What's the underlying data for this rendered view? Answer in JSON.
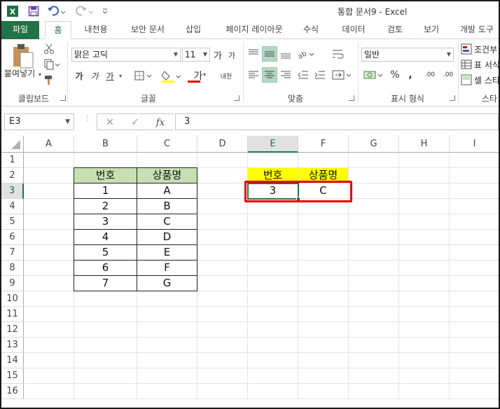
{
  "titlebar": {
    "title": "통합 문서9 - Excel",
    "icons": [
      "excel-logo-icon",
      "save-icon",
      "undo-icon",
      "redo-icon",
      "customize-qat-icon"
    ]
  },
  "tabs": [
    "파일",
    "홈",
    "내전용",
    "보안 문서",
    "삽입",
    "페이지 레이아웃",
    "수식",
    "데이터",
    "검토",
    "보기",
    "개발 도구"
  ],
  "ribbon": {
    "clipboard": {
      "paste": "붙여넣기",
      "label": "클립보드"
    },
    "font": {
      "name": "맑은 고딕",
      "size": "11",
      "label": "글꼴",
      "bold": "가",
      "italic": "가",
      "underline": "가",
      "grow": "가",
      "shrink": "가",
      "font_color": "가",
      "phonetic": "내천"
    },
    "alignment": {
      "label": "맞춤"
    },
    "number": {
      "format": "일반",
      "label": "표시 형식",
      "percent": "%",
      "comma": ",",
      "inc_decimal": ".00",
      "dec_decimal": ".00"
    },
    "styles": {
      "conditional": "조건부",
      "table": "표 서식",
      "cell": "셀 스타",
      "label": "스타"
    },
    "colors": {
      "accent": "#217346",
      "selected": "#b6d7c5"
    }
  },
  "formula_bar": {
    "name_box": "E3",
    "formula": "3",
    "fx": "fx"
  },
  "sheet": {
    "columns": [
      "A",
      "B",
      "C",
      "D",
      "E",
      "F",
      "G",
      "H",
      "I"
    ],
    "rows": [
      "1",
      "2",
      "3",
      "4",
      "5",
      "6",
      "7",
      "8",
      "9",
      "10",
      "11",
      "12",
      "13",
      "14",
      "15",
      "16"
    ],
    "active_column": "E",
    "active_row": "3",
    "table1": {
      "headers": [
        "번호",
        "상품명"
      ],
      "rows": [
        [
          "1",
          "A"
        ],
        [
          "2",
          "B"
        ],
        [
          "3",
          "C"
        ],
        [
          "4",
          "D"
        ],
        [
          "5",
          "E"
        ],
        [
          "6",
          "F"
        ],
        [
          "7",
          "G"
        ]
      ]
    },
    "table2": {
      "headers": [
        "번호",
        "상품명"
      ],
      "row": [
        "3",
        "C"
      ]
    }
  }
}
